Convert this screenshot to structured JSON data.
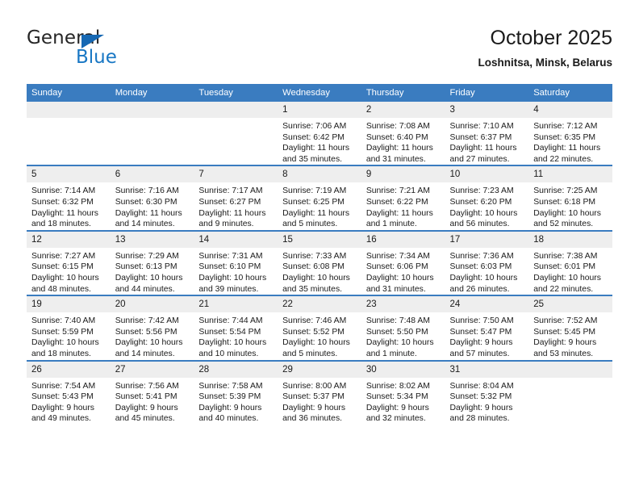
{
  "brand": {
    "name_top": "General",
    "name_bottom": "Blue"
  },
  "header": {
    "title": "October 2025",
    "subtitle": "Loshnitsa, Minsk, Belarus"
  },
  "weekdays": [
    "Sunday",
    "Monday",
    "Tuesday",
    "Wednesday",
    "Thursday",
    "Friday",
    "Saturday"
  ],
  "labels": {
    "sunrise_prefix": "Sunrise: ",
    "sunset_prefix": "Sunset: ",
    "daylight_prefix": "Daylight: "
  },
  "colors": {
    "header_blue": "#3a7cc0",
    "daynum_gray": "#eeeeee",
    "brand_blue": "#1877c4",
    "text": "#1a1a1a"
  },
  "weeks": [
    [
      {
        "empty": true
      },
      {
        "empty": true
      },
      {
        "empty": true
      },
      {
        "day": "1",
        "sunrise": "Sunrise: 7:06 AM",
        "sunset": "Sunset: 6:42 PM",
        "daylight_1": "Daylight: 11 hours",
        "daylight_2": "and 35 minutes."
      },
      {
        "day": "2",
        "sunrise": "Sunrise: 7:08 AM",
        "sunset": "Sunset: 6:40 PM",
        "daylight_1": "Daylight: 11 hours",
        "daylight_2": "and 31 minutes."
      },
      {
        "day": "3",
        "sunrise": "Sunrise: 7:10 AM",
        "sunset": "Sunset: 6:37 PM",
        "daylight_1": "Daylight: 11 hours",
        "daylight_2": "and 27 minutes."
      },
      {
        "day": "4",
        "sunrise": "Sunrise: 7:12 AM",
        "sunset": "Sunset: 6:35 PM",
        "daylight_1": "Daylight: 11 hours",
        "daylight_2": "and 22 minutes."
      }
    ],
    [
      {
        "day": "5",
        "sunrise": "Sunrise: 7:14 AM",
        "sunset": "Sunset: 6:32 PM",
        "daylight_1": "Daylight: 11 hours",
        "daylight_2": "and 18 minutes."
      },
      {
        "day": "6",
        "sunrise": "Sunrise: 7:16 AM",
        "sunset": "Sunset: 6:30 PM",
        "daylight_1": "Daylight: 11 hours",
        "daylight_2": "and 14 minutes."
      },
      {
        "day": "7",
        "sunrise": "Sunrise: 7:17 AM",
        "sunset": "Sunset: 6:27 PM",
        "daylight_1": "Daylight: 11 hours",
        "daylight_2": "and 9 minutes."
      },
      {
        "day": "8",
        "sunrise": "Sunrise: 7:19 AM",
        "sunset": "Sunset: 6:25 PM",
        "daylight_1": "Daylight: 11 hours",
        "daylight_2": "and 5 minutes."
      },
      {
        "day": "9",
        "sunrise": "Sunrise: 7:21 AM",
        "sunset": "Sunset: 6:22 PM",
        "daylight_1": "Daylight: 11 hours",
        "daylight_2": "and 1 minute."
      },
      {
        "day": "10",
        "sunrise": "Sunrise: 7:23 AM",
        "sunset": "Sunset: 6:20 PM",
        "daylight_1": "Daylight: 10 hours",
        "daylight_2": "and 56 minutes."
      },
      {
        "day": "11",
        "sunrise": "Sunrise: 7:25 AM",
        "sunset": "Sunset: 6:18 PM",
        "daylight_1": "Daylight: 10 hours",
        "daylight_2": "and 52 minutes."
      }
    ],
    [
      {
        "day": "12",
        "sunrise": "Sunrise: 7:27 AM",
        "sunset": "Sunset: 6:15 PM",
        "daylight_1": "Daylight: 10 hours",
        "daylight_2": "and 48 minutes."
      },
      {
        "day": "13",
        "sunrise": "Sunrise: 7:29 AM",
        "sunset": "Sunset: 6:13 PM",
        "daylight_1": "Daylight: 10 hours",
        "daylight_2": "and 44 minutes."
      },
      {
        "day": "14",
        "sunrise": "Sunrise: 7:31 AM",
        "sunset": "Sunset: 6:10 PM",
        "daylight_1": "Daylight: 10 hours",
        "daylight_2": "and 39 minutes."
      },
      {
        "day": "15",
        "sunrise": "Sunrise: 7:33 AM",
        "sunset": "Sunset: 6:08 PM",
        "daylight_1": "Daylight: 10 hours",
        "daylight_2": "and 35 minutes."
      },
      {
        "day": "16",
        "sunrise": "Sunrise: 7:34 AM",
        "sunset": "Sunset: 6:06 PM",
        "daylight_1": "Daylight: 10 hours",
        "daylight_2": "and 31 minutes."
      },
      {
        "day": "17",
        "sunrise": "Sunrise: 7:36 AM",
        "sunset": "Sunset: 6:03 PM",
        "daylight_1": "Daylight: 10 hours",
        "daylight_2": "and 26 minutes."
      },
      {
        "day": "18",
        "sunrise": "Sunrise: 7:38 AM",
        "sunset": "Sunset: 6:01 PM",
        "daylight_1": "Daylight: 10 hours",
        "daylight_2": "and 22 minutes."
      }
    ],
    [
      {
        "day": "19",
        "sunrise": "Sunrise: 7:40 AM",
        "sunset": "Sunset: 5:59 PM",
        "daylight_1": "Daylight: 10 hours",
        "daylight_2": "and 18 minutes."
      },
      {
        "day": "20",
        "sunrise": "Sunrise: 7:42 AM",
        "sunset": "Sunset: 5:56 PM",
        "daylight_1": "Daylight: 10 hours",
        "daylight_2": "and 14 minutes."
      },
      {
        "day": "21",
        "sunrise": "Sunrise: 7:44 AM",
        "sunset": "Sunset: 5:54 PM",
        "daylight_1": "Daylight: 10 hours",
        "daylight_2": "and 10 minutes."
      },
      {
        "day": "22",
        "sunrise": "Sunrise: 7:46 AM",
        "sunset": "Sunset: 5:52 PM",
        "daylight_1": "Daylight: 10 hours",
        "daylight_2": "and 5 minutes."
      },
      {
        "day": "23",
        "sunrise": "Sunrise: 7:48 AM",
        "sunset": "Sunset: 5:50 PM",
        "daylight_1": "Daylight: 10 hours",
        "daylight_2": "and 1 minute."
      },
      {
        "day": "24",
        "sunrise": "Sunrise: 7:50 AM",
        "sunset": "Sunset: 5:47 PM",
        "daylight_1": "Daylight: 9 hours",
        "daylight_2": "and 57 minutes."
      },
      {
        "day": "25",
        "sunrise": "Sunrise: 7:52 AM",
        "sunset": "Sunset: 5:45 PM",
        "daylight_1": "Daylight: 9 hours",
        "daylight_2": "and 53 minutes."
      }
    ],
    [
      {
        "day": "26",
        "sunrise": "Sunrise: 7:54 AM",
        "sunset": "Sunset: 5:43 PM",
        "daylight_1": "Daylight: 9 hours",
        "daylight_2": "and 49 minutes."
      },
      {
        "day": "27",
        "sunrise": "Sunrise: 7:56 AM",
        "sunset": "Sunset: 5:41 PM",
        "daylight_1": "Daylight: 9 hours",
        "daylight_2": "and 45 minutes."
      },
      {
        "day": "28",
        "sunrise": "Sunrise: 7:58 AM",
        "sunset": "Sunset: 5:39 PM",
        "daylight_1": "Daylight: 9 hours",
        "daylight_2": "and 40 minutes."
      },
      {
        "day": "29",
        "sunrise": "Sunrise: 8:00 AM",
        "sunset": "Sunset: 5:37 PM",
        "daylight_1": "Daylight: 9 hours",
        "daylight_2": "and 36 minutes."
      },
      {
        "day": "30",
        "sunrise": "Sunrise: 8:02 AM",
        "sunset": "Sunset: 5:34 PM",
        "daylight_1": "Daylight: 9 hours",
        "daylight_2": "and 32 minutes."
      },
      {
        "day": "31",
        "sunrise": "Sunrise: 8:04 AM",
        "sunset": "Sunset: 5:32 PM",
        "daylight_1": "Daylight: 9 hours",
        "daylight_2": "and 28 minutes."
      },
      {
        "empty": true
      }
    ]
  ]
}
